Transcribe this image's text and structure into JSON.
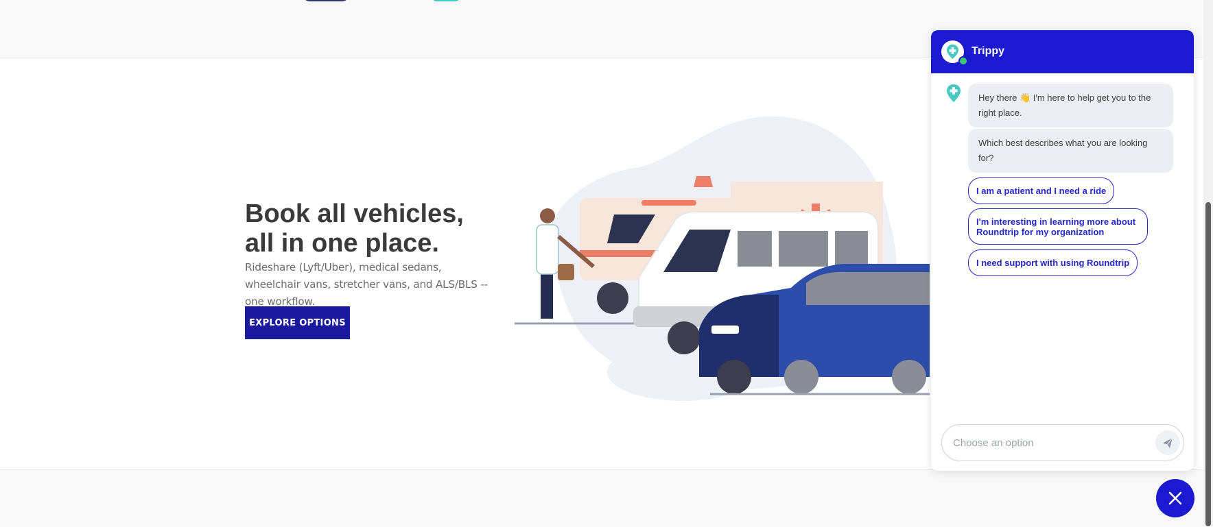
{
  "hero": {
    "title_line1": "Book all vehicles,",
    "title_line2": "all in one place.",
    "description": "Rideshare (Lyft/Uber), medical sedans, wheelchair vans, stretcher vans, and ALS/BLS -- one workflow.",
    "cta_label": "EXPLORE OPTIONS"
  },
  "chat": {
    "bot_name": "Trippy",
    "messages": [
      "Hey there 👋 I'm here to help get you to the right place.",
      "Which best describes what you are looking for?"
    ],
    "options": [
      "I am a patient and I need a ride",
      "I'm interesting in learning more about Roundtrip for my organization",
      "I need support with using Roundtrip"
    ],
    "input_placeholder": "Choose an option"
  },
  "colors": {
    "brand_blue": "#1b1ad1",
    "cta_blue": "#1b1a9e",
    "online_green": "#3ec970",
    "icon_teal": "#46c9c0"
  },
  "icons": {
    "bot_avatar": "medical-cross-pin-icon",
    "send": "paper-plane-icon",
    "close": "close-icon"
  }
}
